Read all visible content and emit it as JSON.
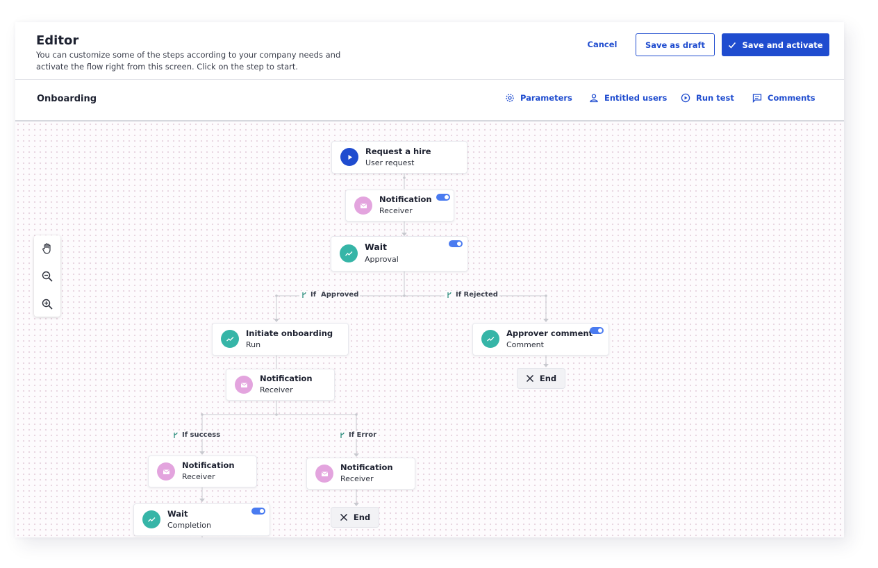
{
  "header": {
    "title": "Editor",
    "subtitle": "You can customize some of the steps according to your company needs and activate the flow right from this screen. Click on the step to start.",
    "cancel_label": "Cancel",
    "draft_label": "Save as draft",
    "activate_label": "Save and activate"
  },
  "subbar": {
    "flow_name": "Onboarding",
    "tools": {
      "parameters": "Parameters",
      "entitled_users": "Entitled users",
      "run_test": "Run test",
      "comments": "Comments"
    }
  },
  "colors": {
    "accent": "#1f4ccf",
    "teal": "#36b5a7",
    "pink": "#e3a4de",
    "toggle": "#4a7bf0"
  },
  "nodes": {
    "request": {
      "title": "Request a hire",
      "subtitle": "User request",
      "icon": "play-icon"
    },
    "notify1": {
      "title": "Notification",
      "subtitle": "Receiver",
      "icon": "mail-icon",
      "enabled": true
    },
    "wait": {
      "title": "Wait",
      "subtitle": "Approval",
      "icon": "trend-icon",
      "enabled": true
    },
    "initiate": {
      "title": "Initiate onboarding",
      "subtitle": "Run",
      "icon": "trend-icon"
    },
    "approver": {
      "title": "Approver comment",
      "subtitle": "Comment",
      "icon": "trend-icon",
      "enabled": true
    },
    "notify2": {
      "title": "Notification",
      "subtitle": "Receiver",
      "icon": "mail-icon"
    },
    "notify3": {
      "title": "Notification",
      "subtitle": "Receiver",
      "icon": "mail-icon"
    },
    "notify4": {
      "title": "Notification",
      "subtitle": "Receiver",
      "icon": "mail-icon"
    },
    "wait2": {
      "title": "Wait",
      "subtitle": "Completion",
      "icon": "trend-icon",
      "enabled": true
    },
    "end1": {
      "label": "End"
    },
    "end2": {
      "label": "End"
    }
  },
  "branches": {
    "approved": "If  Approved",
    "rejected": "If Rejected",
    "success": "If success",
    "error": "If Error"
  }
}
